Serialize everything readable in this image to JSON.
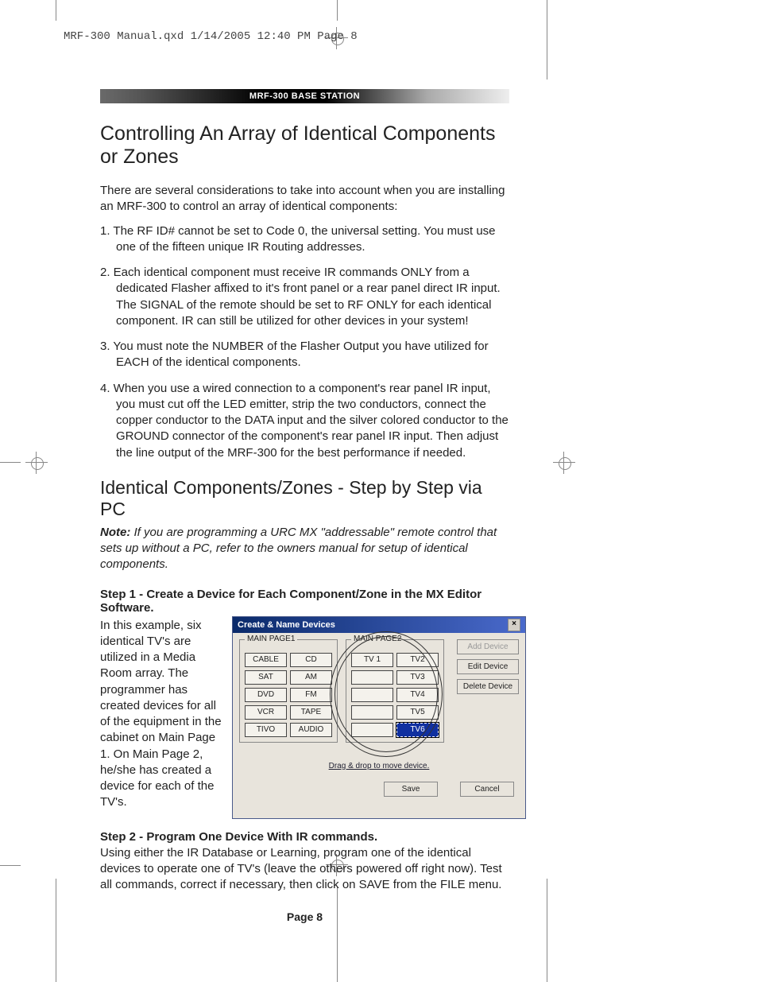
{
  "filepath": "MRF-300 Manual.qxd  1/14/2005  12:40 PM  Page 8",
  "section_bar": "MRF-300 BASE STATION",
  "h1": "Controlling An Array of Identical Components or Zones",
  "intro": "There are several considerations to take into account when you are installing an MRF-300 to control an array of identical components:",
  "list": [
    "1. The RF ID# cannot be set to Code 0, the universal setting. You must use one of the fifteen unique IR Routing addresses.",
    "2. Each identical component must receive IR commands ONLY from a dedicated Flasher affixed to it's front panel or a rear panel direct IR input.  The SIGNAL of the remote should be set to RF ONLY for each identical component. IR can still be utilized for other devices in your system!",
    "3.  You must note the NUMBER of the Flasher Output you have utilized for EACH of the identical components.",
    "4.  When you use a wired connection to a component's rear panel IR input, you must cut off the LED emitter, strip the two conductors, connect the copper conductor to the DATA input and the silver colored conductor to the GROUND connector of the component's rear panel IR input.  Then adjust the line output of the MRF-300 for the best performance if needed."
  ],
  "h2": "Identical Components/Zones - Step by Step via PC",
  "note_label": "Note:",
  "note_body": "  If you are programming a URC MX \"addressable\" remote control that sets up without a PC, refer to the owners manual for setup of identical components.",
  "step1_title": "Step 1 - Create a Device for Each Component/Zone in the MX Editor Software",
  "step1_para": "In this example, six identical TV's are utilized in a Media Room array. The programmer has created devices for all of the equipment in the cabinet on Main Page 1. On Main Page 2, he/she has created a device for each of the TV's.",
  "dialog": {
    "title": "Create & Name Devices",
    "page1_label": "MAIN PAGE1",
    "page2_label": "MAIN PAGE2",
    "page1": [
      "CABLE",
      "CD",
      "SAT",
      "AM",
      "DVD",
      "FM",
      "VCR",
      "TAPE",
      "TIVO",
      "AUDIO"
    ],
    "page2": [
      "TV 1",
      "TV2",
      "",
      "TV3",
      "",
      "TV4",
      "",
      "TV5",
      "",
      "TV6"
    ],
    "selected": "TV6",
    "btn_add": "Add Device",
    "btn_edit": "Edit Device",
    "btn_delete": "Delete Device",
    "drag_hint": "Drag & drop to move device.",
    "btn_save": "Save",
    "btn_cancel": "Cancel"
  },
  "step2_title": "Step 2 - Program One Device With IR commands.",
  "step2_para": "Using either the IR Database or Learning, program one of the identical devices to operate one of TV's (leave the others powered off right now). Test all commands, correct if necessary, then click on SAVE from the FILE menu.",
  "page_number": "Page 8"
}
